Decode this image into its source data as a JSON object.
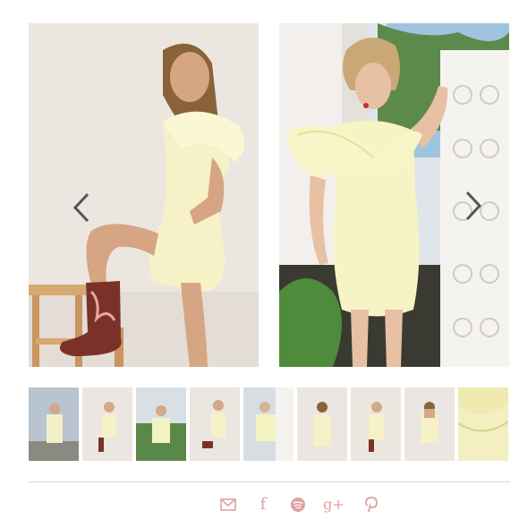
{
  "colors": {
    "accent": "#e0a0a0",
    "dress": "#f5f0b8",
    "background_wall": "#ebe5df"
  },
  "gallery": {
    "nav": {
      "prev_icon": "chevron-left-icon",
      "next_icon": "chevron-right-icon"
    },
    "thumbnail_count": 9
  },
  "share": {
    "icons": [
      "email-icon",
      "facebook-icon",
      "spotify-icon",
      "google-plus-icon",
      "pinterest-icon"
    ],
    "facebook_glyph": "f",
    "googleplus_glyph": "g+"
  }
}
